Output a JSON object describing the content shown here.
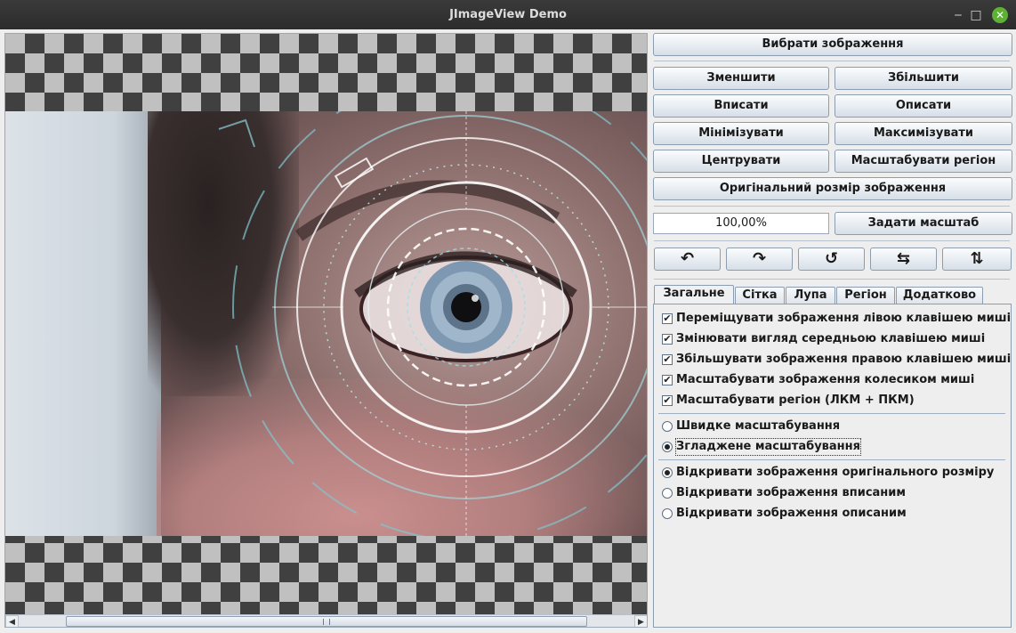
{
  "window": {
    "title": "JImageView Demo",
    "controls": {
      "minimize": "‒",
      "maximize": "□",
      "close": "✕"
    }
  },
  "viewer": {
    "scrollbar": {
      "left_arrow": "◀",
      "right_arrow": "▶"
    }
  },
  "controls": {
    "choose_image": "Вибрати зображення",
    "zoom_out": "Зменшити",
    "zoom_in": "Збільшити",
    "fit": "Вписати",
    "fill": "Описати",
    "minimize": "Мінімізувати",
    "maximize": "Максимізувати",
    "center": "Центрувати",
    "zoom_region": "Масштабувати регіон",
    "original_size": "Оригінальний розмір зображення",
    "zoom_value": "100,00%",
    "set_zoom": "Задати масштаб",
    "icons": {
      "rotate_left": "↶",
      "rotate_right": "↷",
      "reset_rotation": "↺",
      "flip_horizontal": "⇆",
      "flip_vertical": "⇅"
    }
  },
  "tabs": [
    {
      "label": "Загальне",
      "active": true
    },
    {
      "label": "Сітка",
      "active": false
    },
    {
      "label": "Лупа",
      "active": false
    },
    {
      "label": "Регіон",
      "active": false
    },
    {
      "label": "Додатково",
      "active": false
    }
  ],
  "general": {
    "checkboxes": [
      {
        "label": "Переміщувати зображення лівою клавішею миші",
        "checked": true
      },
      {
        "label": "Змінювати вигляд середньою клавішею миші",
        "checked": true
      },
      {
        "label": "Збільшувати зображення правою клавішею миші",
        "checked": true
      },
      {
        "label": "Масштабувати зображення колесиком миші",
        "checked": true
      },
      {
        "label": "Масштабувати регіон (ЛКМ + ПКМ)",
        "checked": true
      }
    ],
    "scaling_radios": [
      {
        "label": "Швидке масштабування",
        "selected": false
      },
      {
        "label": "Згладжене масштабування",
        "selected": true
      }
    ],
    "open_radios": [
      {
        "label": "Відкривати зображення оригінального розміру",
        "selected": true
      },
      {
        "label": "Відкривати зображення вписаним",
        "selected": false
      },
      {
        "label": "Відкривати зображення описаним",
        "selected": false
      }
    ],
    "check_mark": "✔"
  }
}
